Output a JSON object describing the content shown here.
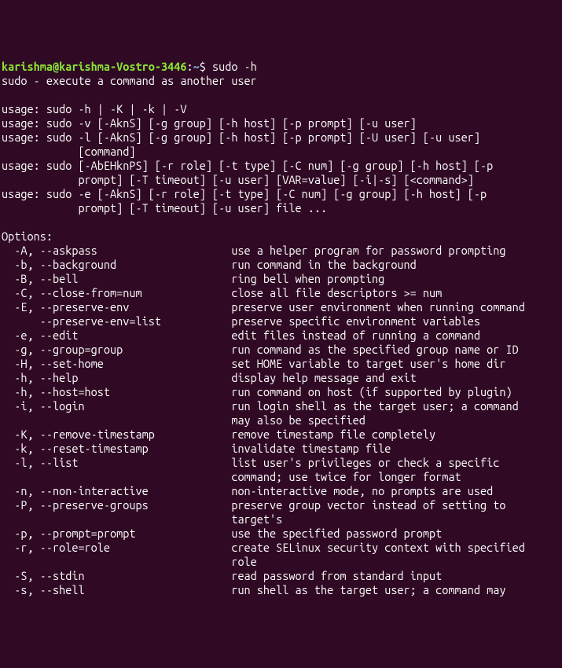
{
  "prompt": {
    "user_host": "karishma@karishma-Vostro-3446",
    "colon": ":",
    "cwd": "~",
    "dollar": "$ ",
    "command": "sudo -h"
  },
  "header": "sudo - execute a command as another user",
  "blank": "",
  "usage": [
    "usage: sudo -h | -K | -k | -V",
    "usage: sudo -v [-AknS] [-g group] [-h host] [-p prompt] [-u user]",
    "usage: sudo -l [-AknS] [-g group] [-h host] [-p prompt] [-U user] [-u user]",
    "            [command]",
    "usage: sudo [-AbEHknPS] [-r role] [-t type] [-C num] [-g group] [-h host] [-p",
    "            prompt] [-T timeout] [-u user] [VAR=value] [-i|-s] [<command>]",
    "usage: sudo -e [-AknS] [-r role] [-t type] [-C num] [-g group] [-h host] [-p",
    "            prompt] [-T timeout] [-u user] file ..."
  ],
  "options_header": "Options:",
  "options": [
    {
      "flag": "  -A, --askpass",
      "desc": "use a helper program for password prompting"
    },
    {
      "flag": "  -b, --background",
      "desc": "run command in the background"
    },
    {
      "flag": "  -B, --bell",
      "desc": "ring bell when prompting"
    },
    {
      "flag": "  -C, --close-from=num",
      "desc": "close all file descriptors >= num"
    },
    {
      "flag": "  -E, --preserve-env",
      "desc": "preserve user environment when running command"
    },
    {
      "flag": "      --preserve-env=list",
      "desc": "preserve specific environment variables"
    },
    {
      "flag": "  -e, --edit",
      "desc": "edit files instead of running a command"
    },
    {
      "flag": "  -g, --group=group",
      "desc": "run command as the specified group name or ID"
    },
    {
      "flag": "  -H, --set-home",
      "desc": "set HOME variable to target user's home dir"
    },
    {
      "flag": "  -h, --help",
      "desc": "display help message and exit"
    },
    {
      "flag": "  -h, --host=host",
      "desc": "run command on host (if supported by plugin)"
    },
    {
      "flag": "  -i, --login",
      "desc": "run login shell as the target user; a command"
    },
    {
      "flag": "",
      "desc": "may also be specified"
    },
    {
      "flag": "  -K, --remove-timestamp",
      "desc": "remove timestamp file completely"
    },
    {
      "flag": "  -k, --reset-timestamp",
      "desc": "invalidate timestamp file"
    },
    {
      "flag": "  -l, --list",
      "desc": "list user's privileges or check a specific"
    },
    {
      "flag": "",
      "desc": "command; use twice for longer format"
    },
    {
      "flag": "  -n, --non-interactive",
      "desc": "non-interactive mode, no prompts are used"
    },
    {
      "flag": "  -P, --preserve-groups",
      "desc": "preserve group vector instead of setting to"
    },
    {
      "flag": "",
      "desc": "target's"
    },
    {
      "flag": "  -p, --prompt=prompt",
      "desc": "use the specified password prompt"
    },
    {
      "flag": "  -r, --role=role",
      "desc": "create SELinux security context with specified"
    },
    {
      "flag": "",
      "desc": "role"
    },
    {
      "flag": "  -S, --stdin",
      "desc": "read password from standard input"
    },
    {
      "flag": "  -s, --shell",
      "desc": "run shell as the target user; a command may"
    }
  ],
  "flag_col_width": 36
}
